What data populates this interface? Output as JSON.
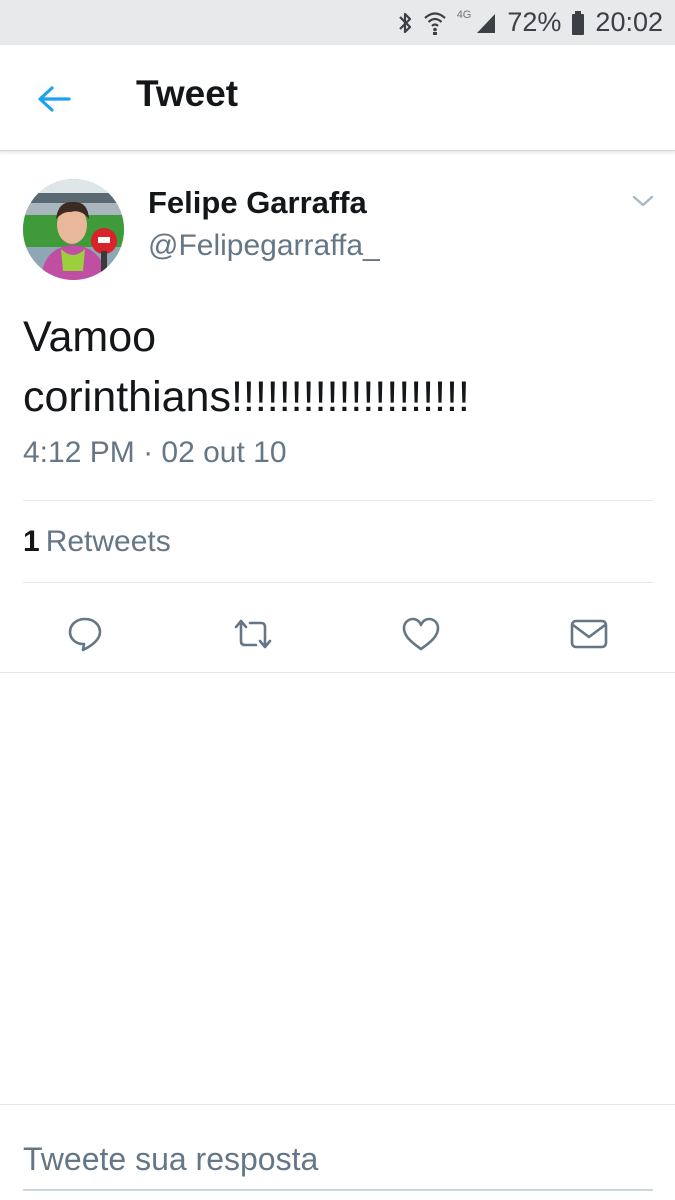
{
  "status_bar": {
    "network": "4G",
    "battery": "72%",
    "time": "20:02",
    "icons": [
      "bluetooth-icon",
      "wifi-icon",
      "signal-icon",
      "battery-icon"
    ]
  },
  "app_bar": {
    "title": "Tweet",
    "back_icon": "back-arrow-icon",
    "accent_color": "#1da1f2"
  },
  "tweet": {
    "author_name": "Felipe Garraffa",
    "author_handle": "@Felipegarraffa_",
    "text": "Vamoo corinthians!!!!!!!!!!!!!!!!!!!!",
    "time": "4:12 PM",
    "separator": "·",
    "date": "02 out 10",
    "retweet_count": "1",
    "retweet_label": "Retweets",
    "actions": [
      "reply-icon",
      "retweet-icon",
      "like-icon",
      "share-message-icon"
    ]
  },
  "reply": {
    "placeholder": "Tweete sua resposta"
  }
}
